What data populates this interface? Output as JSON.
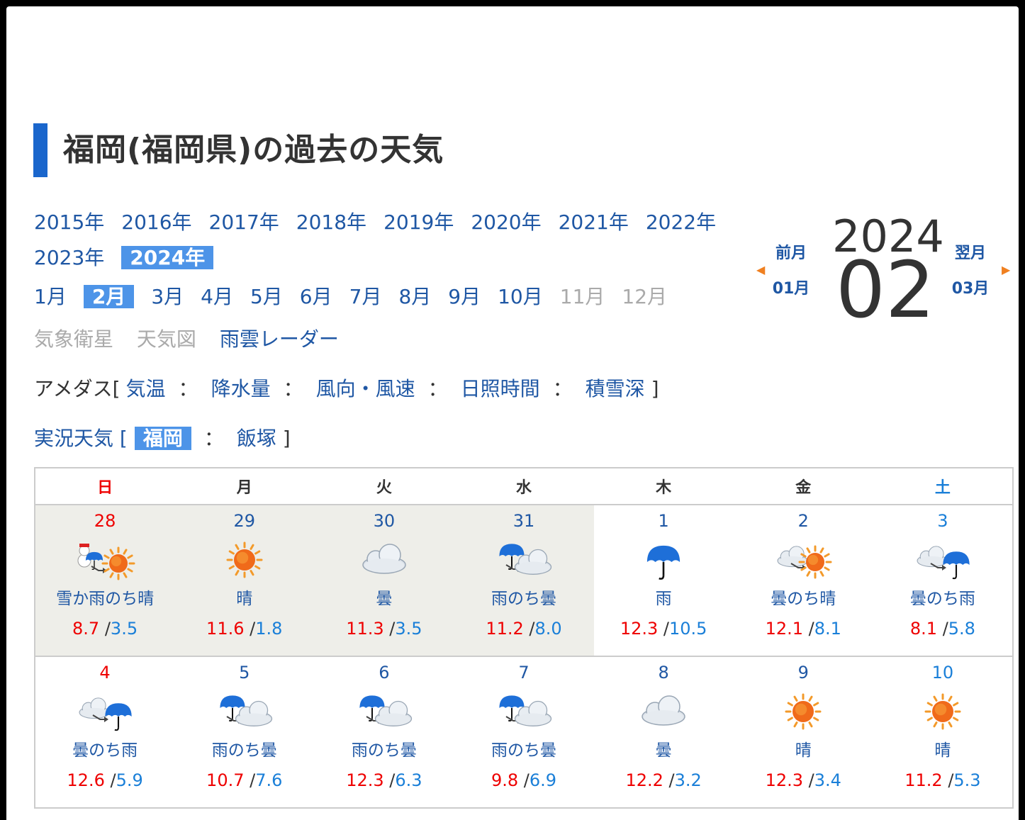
{
  "page": {
    "title": "福岡(福岡県)の過去の天気"
  },
  "years": [
    "2015年",
    "2016年",
    "2017年",
    "2018年",
    "2019年",
    "2020年",
    "2021年",
    "2022年",
    "2023年",
    "2024年"
  ],
  "selected_year": "2024年",
  "months": [
    "1月",
    "2月",
    "3月",
    "4月",
    "5月",
    "6月",
    "7月",
    "8月",
    "9月",
    "10月",
    "11月",
    "12月"
  ],
  "selected_month": "2月",
  "disabled_months": [
    "11月",
    "12月"
  ],
  "links": {
    "satellite": "気象衛星",
    "weather_map": "天気図",
    "radar": "雨雲レーダー"
  },
  "amedas": {
    "label": "アメダス[",
    "items": [
      "気温",
      "降水量",
      "風向・風速",
      "日照時間",
      "積雪深"
    ],
    "close": "]",
    "sep": "："
  },
  "live": {
    "label": "実況天気 [",
    "items": [
      "福岡",
      "飯塚"
    ],
    "selected": "福岡",
    "close": "]",
    "sep": "："
  },
  "nav": {
    "prev_label": "前月",
    "prev_month": "01月",
    "next_label": "翌月",
    "next_month": "03月",
    "year": "2024",
    "month": "02",
    "prev_arrow": "◀",
    "next_arrow": "▶"
  },
  "weekdays": [
    "日",
    "月",
    "火",
    "水",
    "木",
    "金",
    "土"
  ],
  "weeks": [
    [
      {
        "day": "28",
        "icon": "snow-rain-then-sun",
        "weather": "雪か雨のち晴",
        "max": "8.7",
        "min": "3.5",
        "past": true
      },
      {
        "day": "29",
        "icon": "sun",
        "weather": "晴",
        "max": "11.6",
        "min": "1.8",
        "past": true
      },
      {
        "day": "30",
        "icon": "cloud",
        "weather": "曇",
        "max": "11.3",
        "min": "3.5",
        "past": true
      },
      {
        "day": "31",
        "icon": "rain-then-cloud",
        "weather": "雨のち曇",
        "max": "11.2",
        "min": "8.0",
        "past": true
      },
      {
        "day": "1",
        "icon": "rain",
        "weather": "雨",
        "max": "12.3",
        "min": "10.5",
        "past": false
      },
      {
        "day": "2",
        "icon": "cloud-then-sun",
        "weather": "曇のち晴",
        "max": "12.1",
        "min": "8.1",
        "past": false
      },
      {
        "day": "3",
        "icon": "cloud-then-rain",
        "weather": "曇のち雨",
        "max": "8.1",
        "min": "5.8",
        "past": false
      }
    ],
    [
      {
        "day": "4",
        "icon": "cloud-then-rain",
        "weather": "曇のち雨",
        "max": "12.6",
        "min": "5.9",
        "past": false
      },
      {
        "day": "5",
        "icon": "rain-then-cloud",
        "weather": "雨のち曇",
        "max": "10.7",
        "min": "7.6",
        "past": false
      },
      {
        "day": "6",
        "icon": "rain-then-cloud",
        "weather": "雨のち曇",
        "max": "12.3",
        "min": "6.3",
        "past": false
      },
      {
        "day": "7",
        "icon": "rain-then-cloud",
        "weather": "雨のち曇",
        "max": "9.8",
        "min": "6.9",
        "past": false
      },
      {
        "day": "8",
        "icon": "cloud",
        "weather": "曇",
        "max": "12.2",
        "min": "3.2",
        "past": false
      },
      {
        "day": "9",
        "icon": "sun",
        "weather": "晴",
        "max": "12.3",
        "min": "3.4",
        "past": false
      },
      {
        "day": "10",
        "icon": "sun",
        "weather": "晴",
        "max": "11.2",
        "min": "5.3",
        "past": false
      }
    ]
  ],
  "colors": {
    "accent": "#1a66cc",
    "selected_bg": "#4d94e8",
    "link": "#1f57a4",
    "sunday": "#ee0000",
    "saturday": "#1a7fd8",
    "past_bg": "#eeeee9"
  }
}
